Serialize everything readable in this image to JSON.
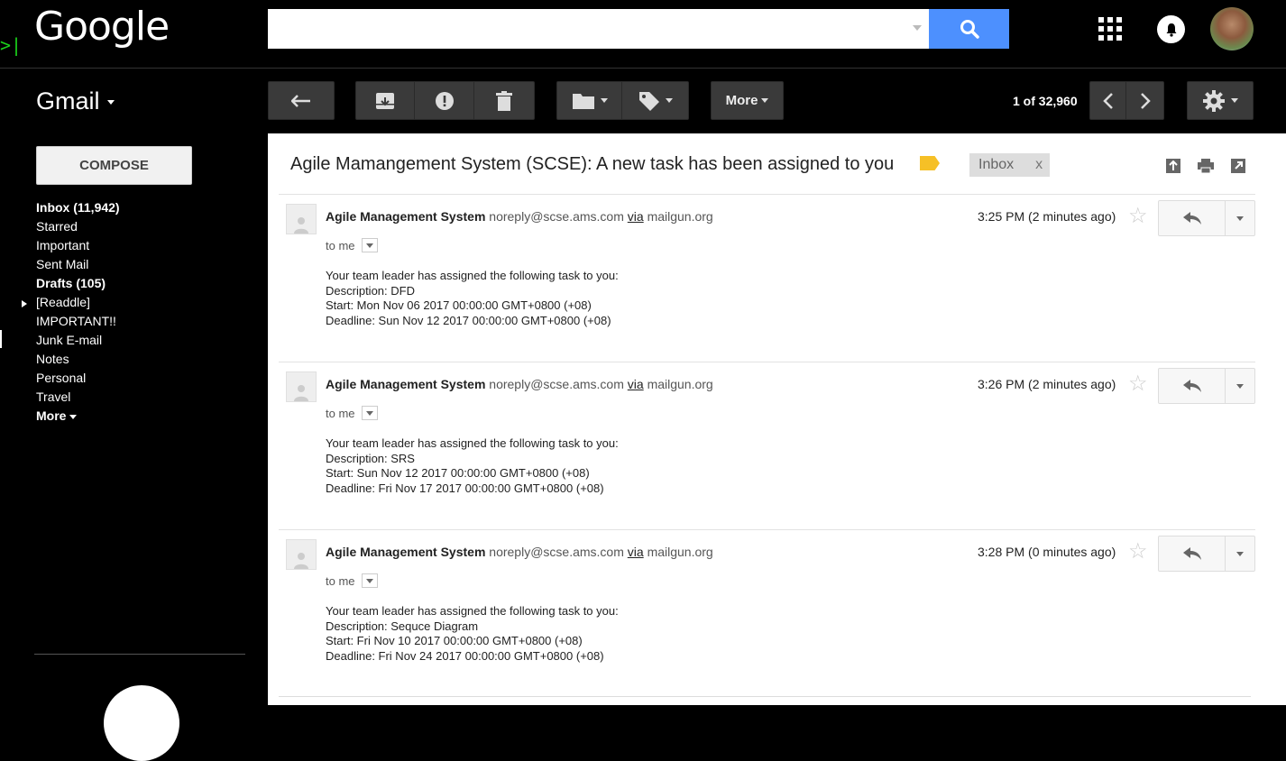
{
  "header": {
    "logo": "Google",
    "search": {
      "placeholder": "",
      "value": ""
    },
    "icons": [
      "search-icon",
      "apps-icon",
      "notifications-icon",
      "avatar"
    ]
  },
  "appbar": {
    "app_name": "Gmail",
    "more_label": "More",
    "count": "1 of 32,960"
  },
  "sidebar": {
    "compose_label": "COMPOSE",
    "folders": [
      {
        "label": "Inbox (11,942)",
        "bold": true
      },
      {
        "label": "Starred",
        "bold": false
      },
      {
        "label": "Important",
        "bold": false
      },
      {
        "label": "Sent Mail",
        "bold": false
      },
      {
        "label": "Drafts (105)",
        "bold": true
      },
      {
        "label": "[Readdle]",
        "bold": false
      },
      {
        "label": "IMPORTANT!!",
        "bold": false
      },
      {
        "label": "Junk E-mail",
        "bold": false
      },
      {
        "label": "Notes",
        "bold": false
      },
      {
        "label": "Personal",
        "bold": false
      },
      {
        "label": "Travel",
        "bold": false
      },
      {
        "label": "More",
        "bold": true
      }
    ]
  },
  "thread": {
    "subject": "Agile Mamangement System (SCSE): A new task has been assigned to you",
    "label_chip": "Inbox",
    "label_chip_close": "x",
    "messages": [
      {
        "sender_name": "Agile Management System",
        "sender_addr": "noreply@scse.ams.com",
        "via": "via",
        "via_domain": "mailgun.org",
        "to": "to me",
        "time": "3:25 PM (2 minutes ago)",
        "lines": [
          "Your team leader has assigned the following task to you:",
          "Description: DFD",
          "Start: Mon Nov 06 2017 00:00:00 GMT+0800 (+08)",
          "Deadline: Sun Nov 12 2017 00:00:00 GMT+0800 (+08)"
        ]
      },
      {
        "sender_name": "Agile Management System",
        "sender_addr": "noreply@scse.ams.com",
        "via": "via",
        "via_domain": "mailgun.org",
        "to": "to me",
        "time": "3:26 PM (2 minutes ago)",
        "lines": [
          "Your team leader has assigned the following task to you:",
          "Description: SRS",
          "Start: Sun Nov 12 2017 00:00:00 GMT+0800 (+08)",
          "Deadline: Fri Nov 17 2017 00:00:00 GMT+0800 (+08)"
        ]
      },
      {
        "sender_name": "Agile Management System",
        "sender_addr": "noreply@scse.ams.com",
        "via": "via",
        "via_domain": "mailgun.org",
        "to": "to me",
        "time": "3:28 PM (0 minutes ago)",
        "lines": [
          "Your team leader has assigned the following task to you:",
          "Description: Sequce Diagram",
          "Start: Fri Nov 10 2017 00:00:00 GMT+0800 (+08)",
          "Deadline: Fri Nov 24 2017 00:00:00 GMT+0800 (+08)"
        ]
      }
    ]
  },
  "colors": {
    "search_button": "#4d90fe",
    "label_tag": "#f6c026",
    "chrome_bg": "#000000"
  }
}
